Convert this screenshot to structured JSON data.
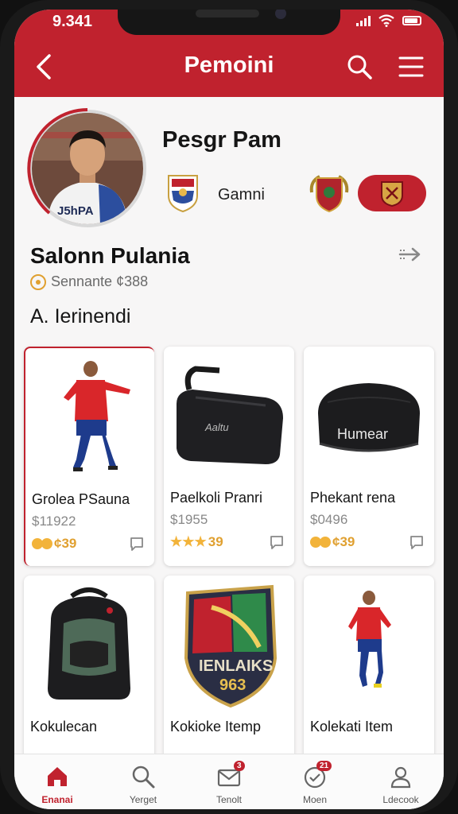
{
  "status_bar": {
    "time": "9.341"
  },
  "nav": {
    "title": "Pemoini"
  },
  "profile": {
    "name": "Pesgr Pam",
    "jersey_text": "J5hPA",
    "club_name": "Gamni"
  },
  "section": {
    "title": "Salonn Pulania",
    "coins_label": "Sennante ¢388",
    "subtitle": "A. Ierinendi"
  },
  "items": [
    {
      "name": "Grolea PSauna",
      "price": "$11922",
      "rating_text": "¢39",
      "icon": "player-figure"
    },
    {
      "name": "Paelkoli Pranri",
      "price": "$1955",
      "rating_text": "39",
      "icon": "duffel-bag"
    },
    {
      "name": "Phekant rena",
      "price": "$0496",
      "rating_text": "¢39",
      "icon": "beanie-hat"
    },
    {
      "name": "Kokulecan",
      "price": "",
      "rating_text": "",
      "icon": "backpack"
    },
    {
      "name": "Kokioke Itemp",
      "price": "",
      "rating_text": "",
      "icon": "shield-crest",
      "crest_text_1": "IENLAIKS",
      "crest_text_2": "963"
    },
    {
      "name": "Kolekati Item",
      "price": "",
      "rating_text": "",
      "icon": "player-figure"
    }
  ],
  "product_label": {
    "hat_text": "Humear",
    "bag_text": "Aaltu"
  },
  "tabs": [
    {
      "label": "Enanai",
      "icon": "home-icon",
      "active": true
    },
    {
      "label": "Yerget",
      "icon": "search-icon"
    },
    {
      "label": "Tenolt",
      "icon": "mail-icon",
      "badge": "3"
    },
    {
      "label": "Moen",
      "icon": "clock-icon",
      "badge": "21"
    },
    {
      "label": "Ldecook",
      "icon": "profile-icon"
    }
  ],
  "colors": {
    "brand_red": "#c0222e",
    "gold": "#f2b33a"
  }
}
